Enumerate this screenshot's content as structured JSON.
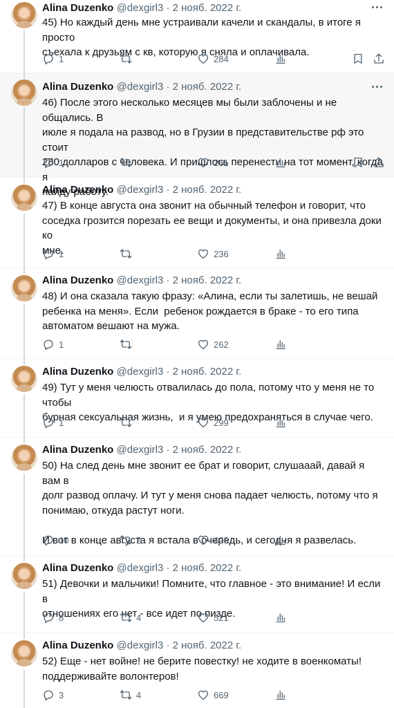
{
  "colors": {
    "text": "#0f1419",
    "muted": "#536471",
    "highlight_bg": "#f7f7f7",
    "divider": "#eff3f4"
  },
  "icons": {
    "reply": "reply-icon",
    "retweet": "retweet-icon",
    "like": "like-icon",
    "views": "views-icon",
    "bookmark": "bookmark-icon",
    "share": "share-icon",
    "more": "more-icon"
  },
  "tweets": [
    {
      "name": "Alina Duzenko",
      "handle": "@dexgirl3",
      "date": "2 нояб. 2022 г.",
      "text": "45) Но каждый день мне устраивали качели и скандалы, в итоге я просто\nсъехала к друзьям с кв, которую я сняла и оплачивала.",
      "replies": "1",
      "retweets": "",
      "likes": "284"
    },
    {
      "name": "Alina Duzenko",
      "handle": "@dexgirl3",
      "date": "2 нояб. 2022 г.",
      "text": "46) После этого несколько месяцев мы были заблочены и не общались. В\nиюле я подала на развод, но в Грузии в представительстве рф это стоит\n280 долларов с человека. И пришлось перенести на тот момент, когда я\nнайду работу.",
      "replies": "1",
      "retweets": "",
      "likes": "261"
    },
    {
      "name": "Alina Duzenko",
      "handle": "@dexgirl3",
      "date": "2 нояб. 2022 г.",
      "text": "47) В конце августа она звонит на обычный телефон и говорит, что\nсоседка грозится порезать ее вещи и документы, и она привезла доки ко\nмне.",
      "replies": "1",
      "retweets": "",
      "likes": "236"
    },
    {
      "name": "Alina Duzenko",
      "handle": "@dexgirl3",
      "date": "2 нояб. 2022 г.",
      "text": "48) И она сказала такую фразу: «Алина, если ты залетишь, не вешай\nребенка на меня». Если  ребенок рождается в браке - то его типа\nавтоматом вешают на мужа.",
      "replies": "1",
      "retweets": "",
      "likes": "262"
    },
    {
      "name": "Alina Duzenko",
      "handle": "@dexgirl3",
      "date": "2 нояб. 2022 г.",
      "text": "49) Тут у меня челюсть отвалилась до пола, потому что у меня не то чтобы\nбурная сексуальная жизнь,  и я умею предохраняться в случае чего.",
      "replies": "1",
      "retweets": "",
      "likes": "299"
    },
    {
      "name": "Alina Duzenko",
      "handle": "@dexgirl3",
      "date": "2 нояб. 2022 г.",
      "text": "50) На след день мне звонит ее брат и говорит, слушааай, давай я вам в\nдолг развод оплачу. И тут у меня снова падает челюсть, потому что я\nпонимаю, откуда растут ноги.\n\nИ вот в конце августа я встала в очередь, и сегодня я развелась.",
      "replies": "10",
      "retweets": "2",
      "likes": "429"
    },
    {
      "name": "Alina Duzenko",
      "handle": "@dexgirl3",
      "date": "2 нояб. 2022 г.",
      "text": "51) Девочки и мальчики! Помните, что главное - это внимание! И если в\nотношениях его нет - все идет по пизде.",
      "replies": "8",
      "retweets": "4",
      "likes": "521"
    },
    {
      "name": "Alina Duzenko",
      "handle": "@dexgirl3",
      "date": "2 нояб. 2022 г.",
      "text": "52) Еще - нет войне! не берите повестку! не ходите в военкоматы!\nподдерживайте волонтеров!",
      "replies": "3",
      "retweets": "4",
      "likes": "669"
    }
  ]
}
